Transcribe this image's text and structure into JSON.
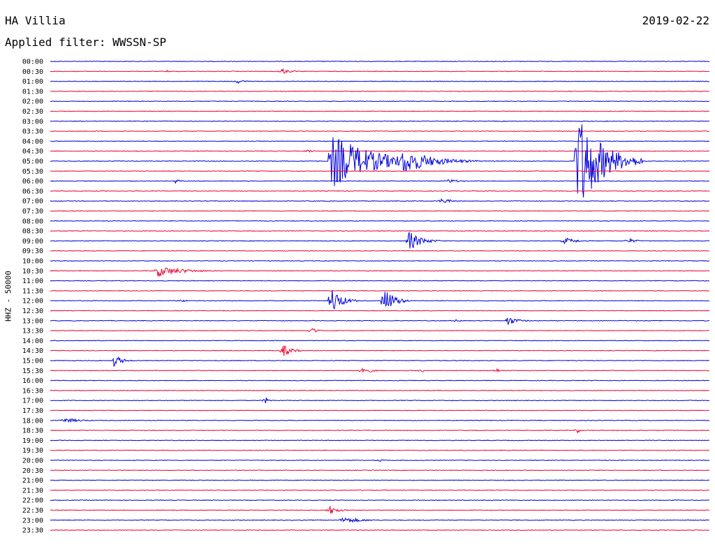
{
  "header": {
    "station": "HA Villia",
    "date": "2019-02-22",
    "filter_label": "Applied filter: WWSSN-SP"
  },
  "colors": {
    "odd_row": "#0000dd",
    "even_row": "#ee0033"
  },
  "chart_data": {
    "type": "line",
    "title": "HA Villia",
    "ylabel": "HHZ - 50000",
    "rows": [
      "00:00",
      "00:30",
      "01:00",
      "01:30",
      "02:00",
      "02:30",
      "03:00",
      "03:30",
      "04:00",
      "04:30",
      "05:00",
      "05:30",
      "06:00",
      "06:30",
      "07:00",
      "07:30",
      "08:00",
      "08:30",
      "09:00",
      "09:30",
      "10:00",
      "10:30",
      "11:00",
      "11:30",
      "12:00",
      "12:30",
      "13:00",
      "13:30",
      "14:00",
      "14:30",
      "15:00",
      "15:30",
      "16:00",
      "16:30",
      "17:00",
      "17:30",
      "18:00",
      "18:30",
      "19:00",
      "19:30",
      "20:00",
      "20:30",
      "21:00",
      "21:30",
      "22:00",
      "22:30",
      "23:00",
      "23:30"
    ],
    "row_minutes": 30,
    "events": [
      {
        "row": 1,
        "minute": 10.5,
        "amp": 5,
        "dur": 1
      },
      {
        "row": 1,
        "minute": 5.3,
        "amp": 2,
        "dur": 0.5
      },
      {
        "row": 2,
        "minute": 8.5,
        "amp": 3,
        "dur": 1
      },
      {
        "row": 9,
        "minute": 11.7,
        "amp": 2,
        "dur": 1
      },
      {
        "row": 10,
        "minute": 12.8,
        "amp": 40,
        "dur": 5
      },
      {
        "row": 10,
        "minute": 15.0,
        "amp": 14,
        "dur": 2.5
      },
      {
        "row": 10,
        "minute": 16.0,
        "amp": 20,
        "dur": 3.5
      },
      {
        "row": 10,
        "minute": 24.0,
        "amp": 75,
        "dur": 3
      },
      {
        "row": 12,
        "minute": 5.7,
        "amp": 4,
        "dur": 0.6
      },
      {
        "row": 12,
        "minute": 18.1,
        "amp": 3,
        "dur": 1.5
      },
      {
        "row": 14,
        "minute": 17.8,
        "amp": 5,
        "dur": 1
      },
      {
        "row": 18,
        "minute": 16.3,
        "amp": 15,
        "dur": 1.5
      },
      {
        "row": 18,
        "minute": 23.4,
        "amp": 5,
        "dur": 1.5
      },
      {
        "row": 18,
        "minute": 26.3,
        "amp": 4,
        "dur": 1
      },
      {
        "row": 21,
        "minute": 4.9,
        "amp": 8,
        "dur": 3
      },
      {
        "row": 24,
        "minute": 12.8,
        "amp": 20,
        "dur": 1.2
      },
      {
        "row": 24,
        "minute": 15.2,
        "amp": 20,
        "dur": 1.2
      },
      {
        "row": 24,
        "minute": 5.9,
        "amp": 3,
        "dur": 0.6
      },
      {
        "row": 26,
        "minute": 20.8,
        "amp": 7,
        "dur": 1.2
      },
      {
        "row": 26,
        "minute": 18.4,
        "amp": 2,
        "dur": 1
      },
      {
        "row": 27,
        "minute": 11.9,
        "amp": 6,
        "dur": 0.6
      },
      {
        "row": 29,
        "minute": 10.6,
        "amp": 9,
        "dur": 1
      },
      {
        "row": 30,
        "minute": 2.9,
        "amp": 9,
        "dur": 1
      },
      {
        "row": 31,
        "minute": 14.2,
        "amp": 6,
        "dur": 1
      },
      {
        "row": 31,
        "minute": 16.9,
        "amp": 3,
        "dur": 0.4
      },
      {
        "row": 31,
        "minute": 20.3,
        "amp": 4,
        "dur": 0.4
      },
      {
        "row": 34,
        "minute": 9.8,
        "amp": 5,
        "dur": 0.4
      },
      {
        "row": 36,
        "minute": 0.6,
        "amp": 4,
        "dur": 2
      },
      {
        "row": 37,
        "minute": 24.0,
        "amp": 4,
        "dur": 0.4
      },
      {
        "row": 40,
        "minute": 14.9,
        "amp": 3,
        "dur": 0.6
      },
      {
        "row": 45,
        "minute": 12.7,
        "amp": 7,
        "dur": 1
      },
      {
        "row": 46,
        "minute": 13.3,
        "amp": 5,
        "dur": 2.2
      }
    ]
  }
}
